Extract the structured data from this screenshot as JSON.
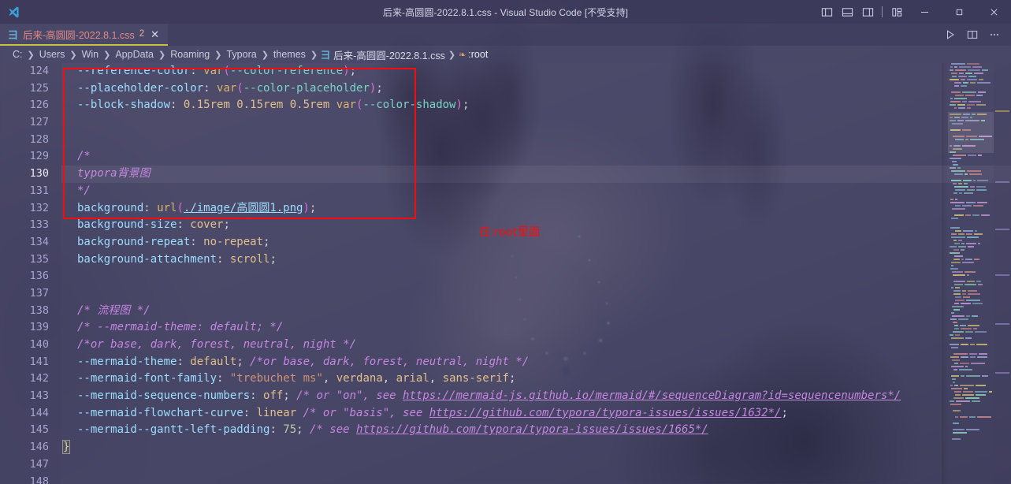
{
  "window": {
    "title": "后来-高圆圆-2022.8.1.css - Visual Studio Code [不受支持]",
    "logo_icon": "vscode-logo-icon",
    "layout_icons": [
      "toggle-primary-sidebar-icon",
      "toggle-panel-icon",
      "toggle-secondary-sidebar-icon",
      "customize-layout-icon"
    ],
    "controls": {
      "minimize": "minimize-icon",
      "maximize": "restore-icon",
      "close": "close-icon"
    }
  },
  "tab": {
    "file_icon": "css-file-icon",
    "label": "后来-高圆圆-2022.8.1.css",
    "badge": "2",
    "close_label": "✕",
    "actions": [
      "run-icon",
      "split-editor-icon",
      "more-actions-icon"
    ]
  },
  "breadcrumb": {
    "items": [
      "C:",
      "Users",
      "Win",
      "AppData",
      "Roaming",
      "Typora",
      "themes"
    ],
    "separator": "❯",
    "file": "后来-高圆圆-2022.8.1.css",
    "file_icon": "css-file-icon",
    "symbol": ":root",
    "symbol_icon": "css-rule-icon"
  },
  "annotation": {
    "note_text": "在:root里面",
    "note_color": "#fb0c0c",
    "box_color": "#f40d0d"
  },
  "editor": {
    "active_line": 130,
    "first_line": 124,
    "lines": [
      {
        "n": 124,
        "tokens": [
          {
            "t": "--reference-color",
            "c": "t-prop"
          },
          {
            "t": ": ",
            "c": "t-punct"
          },
          {
            "t": "var",
            "c": "t-fn"
          },
          {
            "t": "(",
            "c": "t-paren"
          },
          {
            "t": "--color-reference",
            "c": "t-var"
          },
          {
            "t": ")",
            "c": "t-paren"
          },
          {
            "t": ";",
            "c": "t-punct"
          }
        ]
      },
      {
        "n": 125,
        "tokens": [
          {
            "t": "--placeholder-color",
            "c": "t-prop"
          },
          {
            "t": ": ",
            "c": "t-punct"
          },
          {
            "t": "var",
            "c": "t-fn"
          },
          {
            "t": "(",
            "c": "t-paren"
          },
          {
            "t": "--color-placeholder",
            "c": "t-var"
          },
          {
            "t": ")",
            "c": "t-paren"
          },
          {
            "t": ";",
            "c": "t-punct"
          }
        ]
      },
      {
        "n": 126,
        "tokens": [
          {
            "t": "--block-shadow",
            "c": "t-prop"
          },
          {
            "t": ": ",
            "c": "t-punct"
          },
          {
            "t": "0.15rem 0.15rem 0.5rem ",
            "c": "t-val"
          },
          {
            "t": "var",
            "c": "t-fn"
          },
          {
            "t": "(",
            "c": "t-paren"
          },
          {
            "t": "--color-shadow",
            "c": "t-var"
          },
          {
            "t": ")",
            "c": "t-paren"
          },
          {
            "t": ";",
            "c": "t-punct"
          }
        ]
      },
      {
        "n": 127,
        "tokens": []
      },
      {
        "n": 128,
        "tokens": []
      },
      {
        "n": 129,
        "tokens": [
          {
            "t": "/*",
            "c": "t-cmt"
          }
        ]
      },
      {
        "n": 130,
        "tokens": [
          {
            "t": "typora背景图",
            "c": "t-cmt"
          }
        ]
      },
      {
        "n": 131,
        "tokens": [
          {
            "t": "*/",
            "c": "t-cmt"
          }
        ]
      },
      {
        "n": 132,
        "tokens": [
          {
            "t": "background",
            "c": "t-prop"
          },
          {
            "t": ": ",
            "c": "t-punct"
          },
          {
            "t": "url",
            "c": "t-fn"
          },
          {
            "t": "(",
            "c": "t-paren"
          },
          {
            "t": "./image/高圆圆1.png",
            "c": "t-link"
          },
          {
            "t": ")",
            "c": "t-paren"
          },
          {
            "t": ";",
            "c": "t-punct"
          }
        ]
      },
      {
        "n": 133,
        "tokens": [
          {
            "t": "background-size",
            "c": "t-prop"
          },
          {
            "t": ": ",
            "c": "t-punct"
          },
          {
            "t": "cover",
            "c": "t-val"
          },
          {
            "t": ";",
            "c": "t-punct"
          }
        ]
      },
      {
        "n": 134,
        "tokens": [
          {
            "t": "background-repeat",
            "c": "t-prop"
          },
          {
            "t": ": ",
            "c": "t-punct"
          },
          {
            "t": "no-repeat",
            "c": "t-val"
          },
          {
            "t": ";",
            "c": "t-punct"
          }
        ]
      },
      {
        "n": 135,
        "tokens": [
          {
            "t": "background-attachment",
            "c": "t-prop"
          },
          {
            "t": ": ",
            "c": "t-punct"
          },
          {
            "t": "scroll",
            "c": "t-val"
          },
          {
            "t": ";",
            "c": "t-punct"
          }
        ]
      },
      {
        "n": 136,
        "tokens": []
      },
      {
        "n": 137,
        "tokens": []
      },
      {
        "n": 138,
        "tokens": [
          {
            "t": "/* 流程图 */",
            "c": "t-cmt"
          }
        ]
      },
      {
        "n": 139,
        "tokens": [
          {
            "t": "/* --mermaid-theme: default; */",
            "c": "t-cmt"
          }
        ]
      },
      {
        "n": 140,
        "tokens": [
          {
            "t": "/*or base, dark, forest, neutral, night */",
            "c": "t-cmt"
          }
        ]
      },
      {
        "n": 141,
        "tokens": [
          {
            "t": "--mermaid-theme",
            "c": "t-prop"
          },
          {
            "t": ": ",
            "c": "t-punct"
          },
          {
            "t": "default",
            "c": "t-val"
          },
          {
            "t": "; ",
            "c": "t-punct"
          },
          {
            "t": "/*or base, dark, forest, neutral, night */",
            "c": "t-cmt"
          }
        ]
      },
      {
        "n": 142,
        "tokens": [
          {
            "t": "--mermaid-font-family",
            "c": "t-prop"
          },
          {
            "t": ": ",
            "c": "t-punct"
          },
          {
            "t": "\"trebuchet ms\"",
            "c": "t-str"
          },
          {
            "t": ", ",
            "c": "t-punct"
          },
          {
            "t": "verdana",
            "c": "t-val"
          },
          {
            "t": ", ",
            "c": "t-punct"
          },
          {
            "t": "arial",
            "c": "t-val"
          },
          {
            "t": ", ",
            "c": "t-punct"
          },
          {
            "t": "sans-serif",
            "c": "t-val"
          },
          {
            "t": ";",
            "c": "t-punct"
          }
        ]
      },
      {
        "n": 143,
        "tokens": [
          {
            "t": "--mermaid-sequence-numbers",
            "c": "t-prop"
          },
          {
            "t": ": ",
            "c": "t-punct"
          },
          {
            "t": "off",
            "c": "t-val"
          },
          {
            "t": "; ",
            "c": "t-punct"
          },
          {
            "t": "/* or \"on\", see ",
            "c": "t-cmt"
          },
          {
            "t": "https://mermaid-js.github.io/mermaid/#/sequenceDiagram?id=sequencenumbers*/",
            "c": "t-cmtlink"
          }
        ]
      },
      {
        "n": 144,
        "tokens": [
          {
            "t": "--mermaid-flowchart-curve",
            "c": "t-prop"
          },
          {
            "t": ": ",
            "c": "t-punct"
          },
          {
            "t": "linear",
            "c": "t-val"
          },
          {
            "t": " ",
            "c": "t-punct"
          },
          {
            "t": "/* or \"basis\", see ",
            "c": "t-cmt"
          },
          {
            "t": "https://github.com/typora/typora-issues/issues/1632*/",
            "c": "t-cmtlink"
          },
          {
            "t": ";",
            "c": "t-punct"
          }
        ]
      },
      {
        "n": 145,
        "tokens": [
          {
            "t": "--mermaid--gantt-left-padding",
            "c": "t-prop"
          },
          {
            "t": ": ",
            "c": "t-punct"
          },
          {
            "t": "75",
            "c": "t-num"
          },
          {
            "t": "; ",
            "c": "t-punct"
          },
          {
            "t": "/* see ",
            "c": "t-cmt"
          },
          {
            "t": "https://github.com/typora/typora-issues/issues/1665*/",
            "c": "t-cmtlink"
          }
        ]
      },
      {
        "n": 146,
        "tokens": [
          {
            "t": "}",
            "c": "t-brace brace-box"
          }
        ],
        "indent": 0
      },
      {
        "n": 147,
        "tokens": []
      },
      {
        "n": 148,
        "tokens": []
      }
    ]
  },
  "minimap": {
    "name": "minimap",
    "rows": 120
  }
}
